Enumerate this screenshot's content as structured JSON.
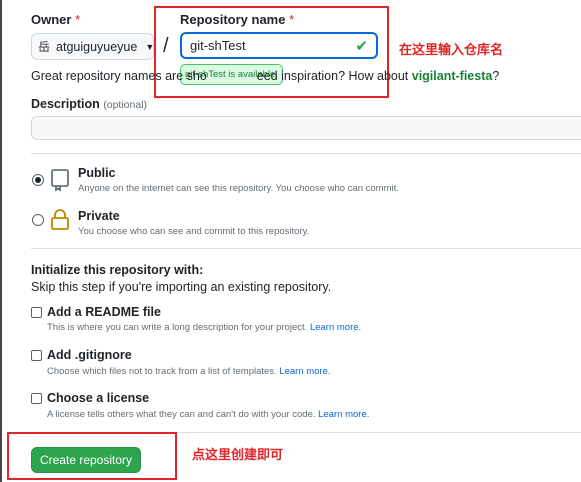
{
  "owner": {
    "label": "Owner",
    "required_mark": "*",
    "avatar_glyph": "岳",
    "name": "atguiguyueyue"
  },
  "separator": "/",
  "repo": {
    "label": "Repository name",
    "required_mark": "*",
    "value": "git-shTest",
    "available_text": "git-shTest is available.",
    "annotation": "在这里输入仓库名"
  },
  "hint": {
    "before": "Great repository names are sho",
    "after": "eed inspiration? How about ",
    "suggestion": "vigilant-fiesta",
    "end": "?"
  },
  "description": {
    "label": "Description",
    "optional": "(optional)",
    "value": ""
  },
  "visibility": {
    "public": {
      "title": "Public",
      "desc": "Anyone on the internet can see this repository. You choose who can commit.",
      "selected": true
    },
    "private": {
      "title": "Private",
      "desc": "You choose who can see and commit to this repository.",
      "selected": false
    }
  },
  "init": {
    "title": "Initialize this repository with:",
    "subtitle": "Skip this step if you're importing an existing repository.",
    "readme": {
      "title": "Add a README file",
      "desc": "This is where you can write a long description for your project. ",
      "link": "Learn more."
    },
    "gitignore": {
      "title": "Add .gitignore",
      "desc": "Choose which files not to track from a list of templates. ",
      "link": "Learn more."
    },
    "license": {
      "title": "Choose a license",
      "desc": "A license tells others what they can and can't do with your code. ",
      "link": "Learn more."
    }
  },
  "create": {
    "label": "Create repository",
    "annotation": "点这里创建即可"
  },
  "colors": {
    "accent_blue": "#0969da",
    "success_green": "#2da44e",
    "annotation_red": "#e0262a"
  }
}
